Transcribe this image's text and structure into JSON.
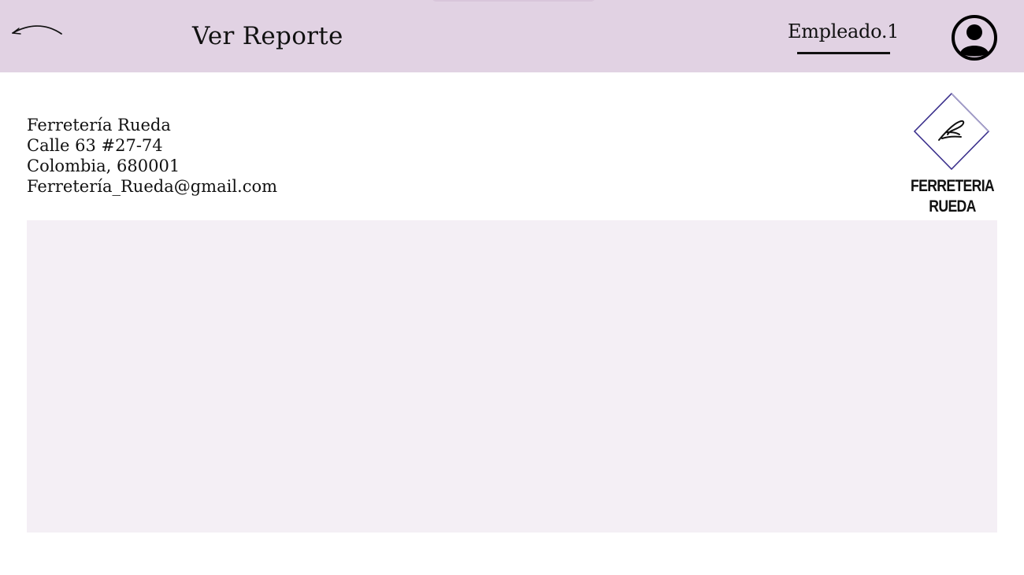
{
  "header": {
    "title": "Ver Reporte",
    "user_name": "Empleado.1",
    "back_icon": "back-arrow-icon",
    "avatar_icon": "user-circle-icon"
  },
  "company": {
    "name": "Ferretería Rueda",
    "address": "Calle 63 #27-74",
    "city": "Colombia, 680001",
    "email": "Ferretería_Rueda@gmail.com"
  },
  "logo": {
    "text": "FERRETERIA RUEDA",
    "icon": "ferreteria-rueda-logo-icon"
  },
  "colors": {
    "header_bg": "#e1d2e3",
    "panel_bg": "#f4eff5",
    "logo_accent": "#3a2f8c",
    "text": "#111111"
  }
}
